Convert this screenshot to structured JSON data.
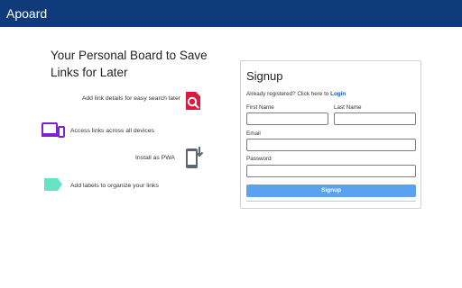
{
  "app": {
    "brand": "Apoard"
  },
  "hero": {
    "headline": "Your Personal Board to Save Links for Later"
  },
  "features": [
    {
      "text": "Add link details for easy search later",
      "icon": "search-document-icon",
      "color": "#d81b3f"
    },
    {
      "text": "Access links across all devices",
      "icon": "devices-icon",
      "color": "#7b22d4"
    },
    {
      "text": "Install as PWA",
      "icon": "install-phone-icon",
      "color": "#5c6670"
    },
    {
      "text": "Add labels to organize your links",
      "icon": "label-tag-icon",
      "color": "#66e3c4"
    }
  ],
  "signup": {
    "title": "Signup",
    "registered_prefix": "Already registered? Click here to",
    "login_link": "Login",
    "first_name_label": "First Name",
    "first_name_value": "",
    "last_name_label": "Last Name",
    "last_name_value": "",
    "email_label": "Email",
    "email_value": "",
    "password_label": "Password",
    "password_value": "",
    "submit_label": "Signup"
  },
  "colors": {
    "navbar": "#103b7a",
    "button": "#5aa2ef",
    "link": "#1a56c2"
  }
}
